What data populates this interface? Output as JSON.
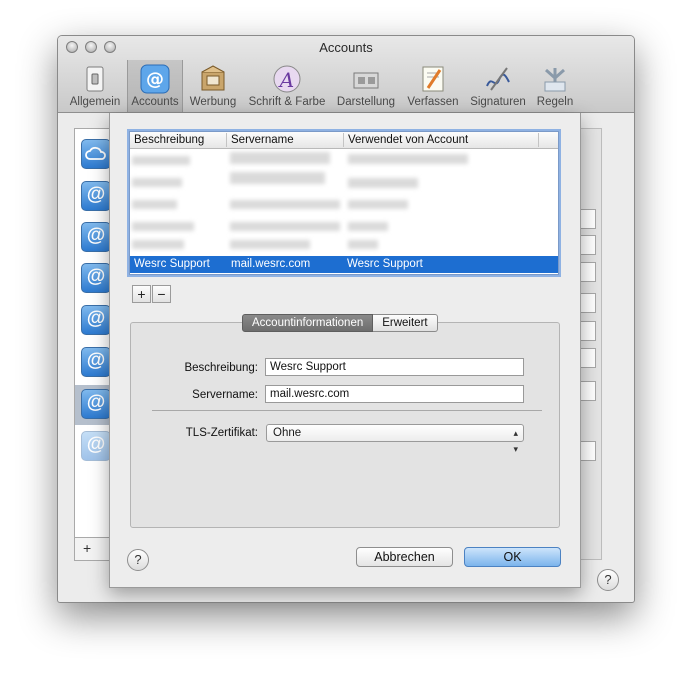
{
  "window": {
    "title": "Accounts"
  },
  "toolbar": {
    "items": [
      {
        "label": "Allgemein",
        "icon": "switch-icon"
      },
      {
        "label": "Accounts",
        "icon": "at-sign-icon",
        "selected": true
      },
      {
        "label": "Werbung",
        "icon": "junk-mail-icon"
      },
      {
        "label": "Schrift & Farbe",
        "icon": "font-color-icon"
      },
      {
        "label": "Darstellung",
        "icon": "viewing-icon"
      },
      {
        "label": "Verfassen",
        "icon": "composing-icon"
      },
      {
        "label": "Signaturen",
        "icon": "signature-icon"
      },
      {
        "label": "Regeln",
        "icon": "rules-icon"
      }
    ]
  },
  "sidebar": {
    "add_label": "+",
    "help_label": "?"
  },
  "sheet": {
    "table": {
      "columns": [
        "Beschreibung",
        "Servername",
        "Verwendet von Account"
      ],
      "selected_row": {
        "description": "Wesrc Support",
        "server": "mail.wesrc.com",
        "used_by": "Wesrc Support"
      }
    },
    "add_button": "+",
    "remove_button": "−",
    "tabs": [
      {
        "label": "Accountinformationen",
        "active": true
      },
      {
        "label": "Erweitert"
      }
    ],
    "fields": {
      "description_label": "Beschreibung:",
      "description_value": "Wesrc Support",
      "server_label": "Servername:",
      "server_value": "mail.wesrc.com",
      "tls_label": "TLS-Zertifikat:",
      "tls_value": "Ohne"
    },
    "buttons": {
      "cancel": "Abbrechen",
      "ok": "OK",
      "help": "?"
    }
  },
  "colors": {
    "selection": "#1d6ed1",
    "accent": "#2d7ad0"
  }
}
